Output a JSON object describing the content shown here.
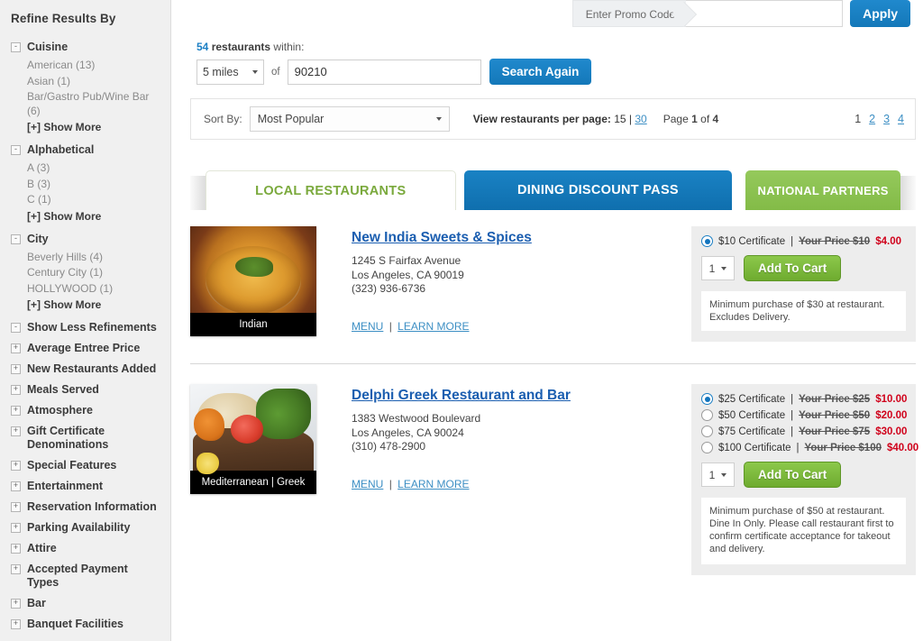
{
  "sidebar": {
    "title": "Refine Results By",
    "facets": [
      {
        "name": "Cuisine",
        "toggle": "-",
        "values": [
          "American (13)",
          "Asian (1)",
          "Bar/Gastro Pub/Wine Bar (6)"
        ],
        "show_more": "[+] Show More"
      },
      {
        "name": "Alphabetical",
        "toggle": "-",
        "values": [
          "A (3)",
          "B (3)",
          "C (1)"
        ],
        "show_more": "[+] Show More"
      },
      {
        "name": "City",
        "toggle": "-",
        "values": [
          "Beverly Hills (4)",
          "Century City (1)",
          "HOLLYWOOD (1)"
        ],
        "show_more": "[+] Show More"
      },
      {
        "name": "Show Less Refinements",
        "toggle": "-",
        "values": [],
        "show_more": ""
      },
      {
        "name": "Average Entree Price",
        "toggle": "+",
        "values": [],
        "show_more": ""
      },
      {
        "name": "New Restaurants Added",
        "toggle": "+",
        "values": [],
        "show_more": ""
      },
      {
        "name": "Meals Served",
        "toggle": "+",
        "values": [],
        "show_more": ""
      },
      {
        "name": "Atmosphere",
        "toggle": "+",
        "values": [],
        "show_more": ""
      },
      {
        "name": "Gift Certificate Denominations",
        "toggle": "+",
        "values": [],
        "show_more": ""
      },
      {
        "name": "Special Features",
        "toggle": "+",
        "values": [],
        "show_more": ""
      },
      {
        "name": "Entertainment",
        "toggle": "+",
        "values": [],
        "show_more": ""
      },
      {
        "name": "Reservation Information",
        "toggle": "+",
        "values": [],
        "show_more": ""
      },
      {
        "name": "Parking Availability",
        "toggle": "+",
        "values": [],
        "show_more": ""
      },
      {
        "name": "Attire",
        "toggle": "+",
        "values": [],
        "show_more": ""
      },
      {
        "name": "Accepted Payment Types",
        "toggle": "+",
        "values": [],
        "show_more": ""
      },
      {
        "name": "Bar",
        "toggle": "+",
        "values": [],
        "show_more": ""
      },
      {
        "name": "Banquet Facilities",
        "toggle": "+",
        "values": [],
        "show_more": ""
      }
    ]
  },
  "promo": {
    "label": "Enter Promo Code",
    "value": "",
    "placeholder": "",
    "apply_label": "Apply"
  },
  "search": {
    "count": "54",
    "count_word": "restaurants",
    "within_text": "within:",
    "distance": "5 miles",
    "of_text": "of",
    "zip": "90210",
    "button_label": "Search Again"
  },
  "sortbar": {
    "sort_label": "Sort By:",
    "sort_value": "Most Popular",
    "per_page_label": "View restaurants per page:",
    "per_page_15": "15",
    "per_page_divider": "|",
    "per_page_30": "30",
    "page_prefix": "Page",
    "page_current": "1",
    "page_mid": "of",
    "page_total": "4",
    "pages": [
      "1",
      "2",
      "3",
      "4"
    ]
  },
  "tabs": [
    {
      "label": "LOCAL RESTAURANTS",
      "active": true
    },
    {
      "label": "DINING DISCOUNT PASS",
      "active": false
    },
    {
      "label": "NATIONAL PARTNERS",
      "active": false
    }
  ],
  "listings": [
    {
      "name": "New India Sweets & Spices",
      "cuisine_caption": "Indian",
      "address1": "1245 S Fairfax Avenue",
      "address2": "Los Angeles, CA 90019",
      "phone": "(323) 936-6736",
      "menu_link": "MENU",
      "separator": "|",
      "learn_more_link": "LEARN MORE",
      "certificates": [
        {
          "label": "$10 Certificate",
          "sep": "|",
          "old_price": "Your Price $10",
          "new_price": "$4.00",
          "selected": true
        }
      ],
      "quantity": "1",
      "add_to_cart": "Add To Cart",
      "note": "Minimum purchase of $30 at restaurant. Excludes Delivery."
    },
    {
      "name": "Delphi Greek Restaurant and Bar",
      "cuisine_caption": "Mediterranean | Greek",
      "address1": "1383 Westwood Boulevard",
      "address2": "Los Angeles, CA 90024",
      "phone": "(310) 478-2900",
      "menu_link": "MENU",
      "separator": "|",
      "learn_more_link": "LEARN MORE",
      "certificates": [
        {
          "label": "$25 Certificate",
          "sep": "|",
          "old_price": "Your Price $25",
          "new_price": "$10.00",
          "selected": true
        },
        {
          "label": "$50 Certificate",
          "sep": "|",
          "old_price": "Your Price $50",
          "new_price": "$20.00",
          "selected": false
        },
        {
          "label": "$75 Certificate",
          "sep": "|",
          "old_price": "Your Price $75",
          "new_price": "$30.00",
          "selected": false
        },
        {
          "label": "$100 Certificate",
          "sep": "|",
          "old_price": "Your Price $100",
          "new_price": "$40.00",
          "selected": false
        }
      ],
      "quantity": "1",
      "add_to_cart": "Add To Cart",
      "note": "Minimum purchase of $50 at restaurant. Dine In Only. Please call restaurant first to confirm certificate acceptance for takeout and delivery."
    }
  ],
  "colors": {
    "accent_blue": "#1b7fc4",
    "accent_green": "#8cc851",
    "link_blue": "#3d8fc4",
    "price_red": "#d0021b",
    "tab_local_text": "#7aa93c"
  }
}
